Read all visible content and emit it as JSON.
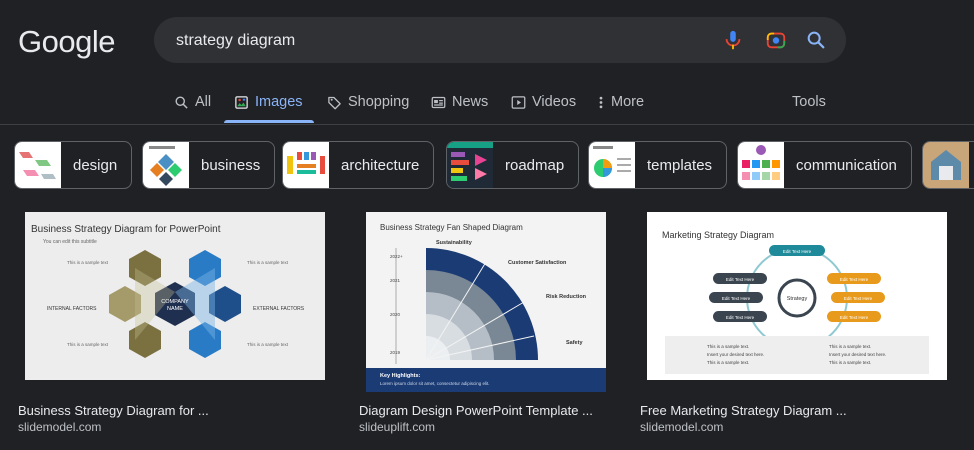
{
  "logo": "Google",
  "search": {
    "query": "strategy diagram"
  },
  "tabs": [
    {
      "label": "All",
      "icon": "search-icon"
    },
    {
      "label": "Images",
      "icon": "images-icon"
    },
    {
      "label": "Shopping",
      "icon": "tag-icon"
    },
    {
      "label": "News",
      "icon": "news-icon"
    },
    {
      "label": "Videos",
      "icon": "play-icon"
    },
    {
      "label": "More",
      "icon": "more-vert-icon"
    }
  ],
  "tools_label": "Tools",
  "chips": [
    "design",
    "business",
    "architecture",
    "roadmap",
    "templates",
    "communication"
  ],
  "results": [
    {
      "title": "Business Strategy Diagram for ...",
      "source": "slidemodel.com",
      "image": {
        "heading": "Business Strategy Diagram for PowerPoint",
        "subtitle": "You can edit this subtitle",
        "left_label": "INTERNAL FACTORS",
        "right_label": "EXTERNAL FACTORS",
        "center_label_1": "COMPANY",
        "center_label_2": "NAME",
        "sample": "This is a sample text"
      }
    },
    {
      "title": "Diagram Design PowerPoint Template ...",
      "source": "slideuplift.com",
      "image": {
        "heading": "Business Strategy Fan Shaped Diagram",
        "labels": [
          "Sustainability",
          "Customer Satisfaction",
          "Risk Reduction",
          "Safety"
        ],
        "years": [
          "2022+",
          "2021",
          "2020",
          "2019"
        ],
        "footer_title": "Key Highlights:",
        "footer_text": "Lorem ipsum dolor sit amet, consectetur adipiscing elit."
      }
    },
    {
      "title": "Free Marketing Strategy Diagram ...",
      "source": "slidemodel.com",
      "image": {
        "heading": "Marketing Strategy Diagram",
        "center": "Strategy",
        "edit": "Edit Text Here",
        "bullets": [
          "This is a sample text.",
          "Insert your desired text here.",
          "This is a sample text."
        ]
      }
    }
  ],
  "colors": {
    "accent": "#8ab4f8",
    "background": "#202124",
    "surface": "#303134",
    "hex_olive": "#7a7040",
    "hex_blue": "#2a7bc6",
    "hex_navy": "#1f4f8a",
    "fan_navy": "#1b3b75",
    "mkt_teal": "#1f8a99",
    "mkt_orange": "#e79a1c",
    "mkt_dark": "#3a4550"
  }
}
